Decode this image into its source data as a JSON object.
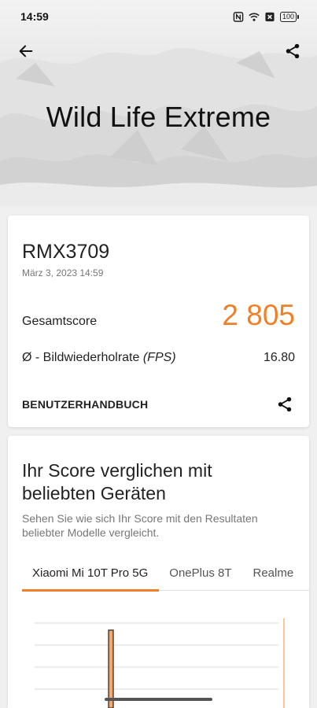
{
  "status": {
    "time": "14:59",
    "battery": "100",
    "icons": [
      "nfc-icon",
      "wifi-icon",
      "sim-off-icon",
      "battery-icon"
    ]
  },
  "header": {
    "title": "Wild Life Extreme",
    "back_icon": "arrow-left-icon",
    "share_icon": "share-icon"
  },
  "result": {
    "device": "RMX3709",
    "date": "März 3, 2023 14:59",
    "total_label": "Gesamtscore",
    "total_value": "2 805",
    "fps_label_prefix": "Ø - Bildwiederholrate ",
    "fps_label_unit": "(FPS)",
    "fps_value": "16.80",
    "manual_label": "BENUTZERHANDBUCH"
  },
  "compare": {
    "title": "Ihr Score verglichen mit beliebten Geräten",
    "description": "Sehen Sie wie sich Ihr Score mit den Resultaten beliebter Modelle vergleicht.",
    "tabs": [
      {
        "label": "Xiaomi Mi 10T Pro 5G",
        "active": true
      },
      {
        "label": "OnePlus 8T",
        "active": false
      },
      {
        "label": "Realme",
        "active": false
      }
    ]
  },
  "colors": {
    "accent": "#f07f27",
    "text": "#222222",
    "muted": "#777777"
  }
}
